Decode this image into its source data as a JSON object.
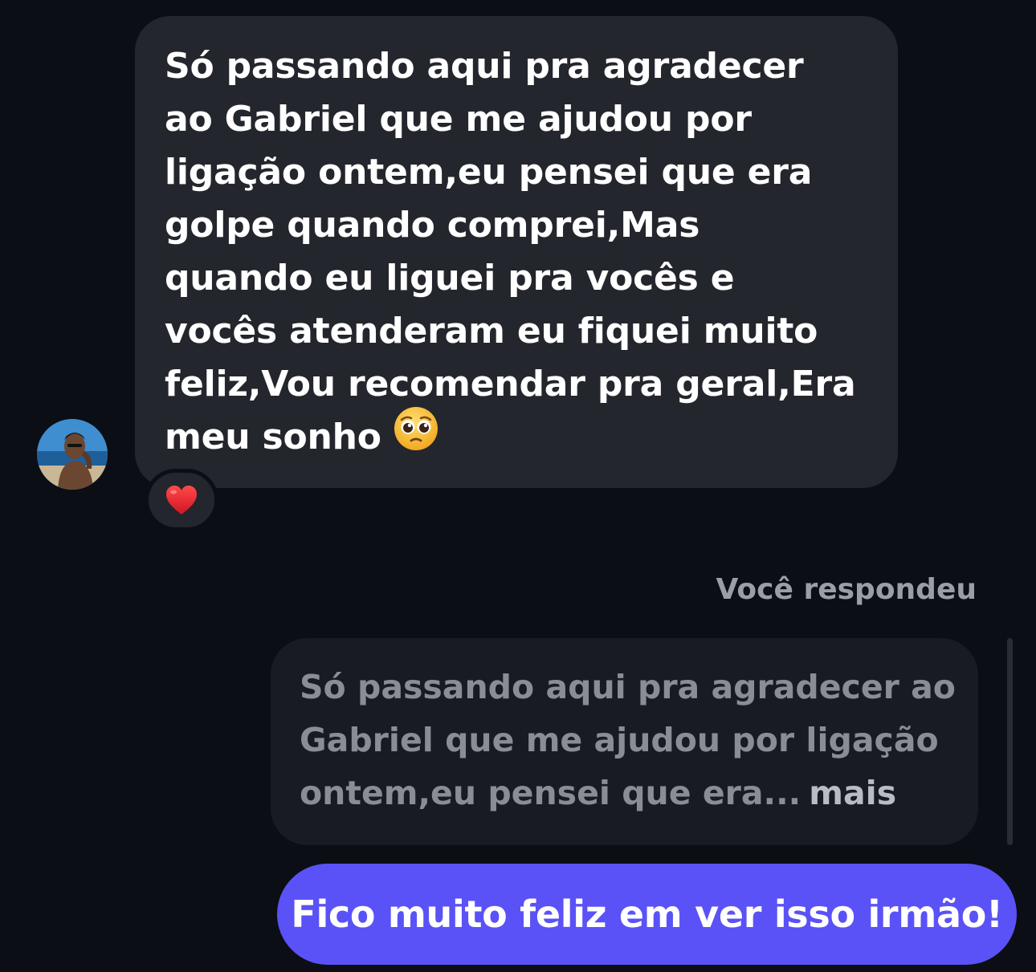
{
  "incoming_message": {
    "lines": [
      "Só passando aqui pra agradecer",
      "ao Gabriel que me ajudou por",
      "ligação ontem,eu pensei que era",
      "golpe quando comprei,Mas",
      "quando eu liguei pra vocês e",
      "vocês atenderam eu fiquei muito",
      "feliz,Vou recomendar pra geral,Era",
      "meu sonho"
    ],
    "trailing_emoji_icon": "pleading-face-icon",
    "reaction_icon": "red-heart-icon",
    "sender_avatar_icon": "avatar-photo"
  },
  "reply_context": {
    "label": "Você respondeu",
    "quoted_lines": [
      "Só passando aqui pra agradecer ao",
      "Gabriel que me ajudou por ligação",
      "ontem,eu pensei que era..."
    ],
    "more_label": "mais"
  },
  "outgoing_message": {
    "text": "Fico muito feliz em ver isso irmão!"
  },
  "colors": {
    "background": "#0b0e15",
    "incoming_bubble": "#24262d",
    "quoted_bubble": "#191b22",
    "outgoing_bubble": "#5a52f6",
    "muted_text": "#9b9ea7",
    "heart": "#e0242f",
    "emoji_face": "#f8c33a"
  }
}
